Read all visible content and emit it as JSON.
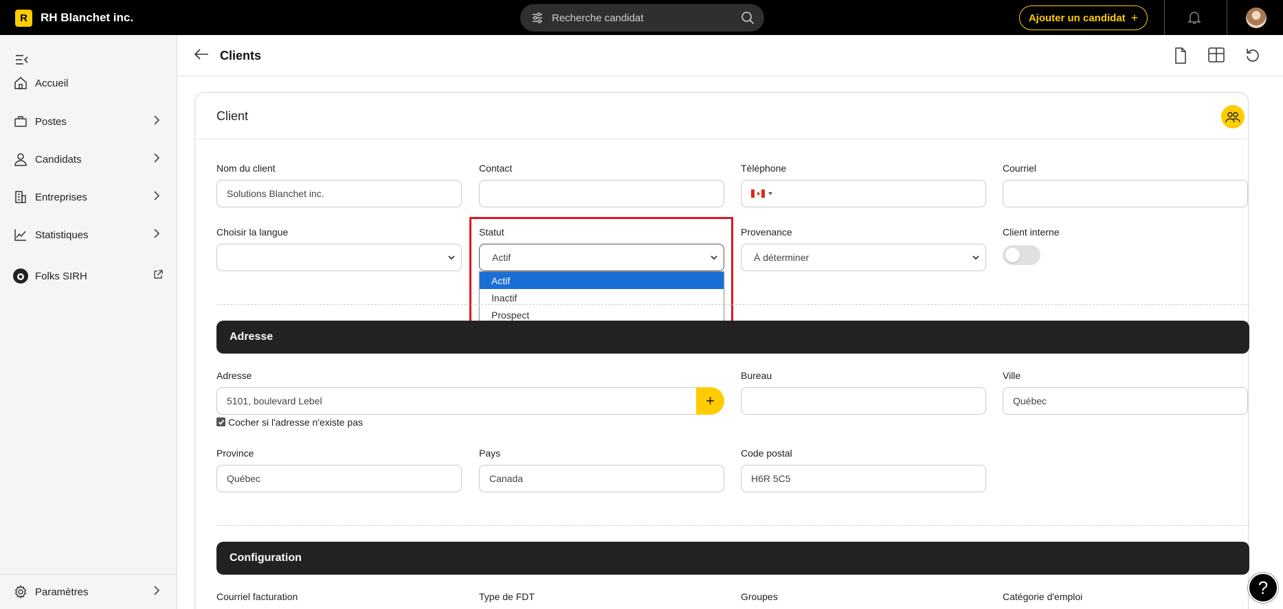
{
  "app": {
    "logo_letter": "R",
    "brand": "RH Blanchet inc."
  },
  "topbar": {
    "search_placeholder": "Recherche candidat",
    "add_candidate_label": "Ajouter un candidat",
    "add_candidate_icon": "+"
  },
  "sidebar": {
    "items": [
      {
        "label": "Accueil",
        "icon": "home-icon"
      },
      {
        "label": "Postes",
        "icon": "briefcase-icon",
        "chevron": "›"
      },
      {
        "label": "Candidats",
        "icon": "user-icon",
        "chevron": "›"
      },
      {
        "label": "Entreprises",
        "icon": "building-icon",
        "chevron": "›"
      },
      {
        "label": "Statistiques",
        "icon": "chart-icon",
        "chevron": "›"
      },
      {
        "label": "Folks SIRH",
        "icon": "folks-logo-icon",
        "external": "external-link-icon"
      }
    ],
    "settings_label": "Paramètres",
    "settings_chevron": "›"
  },
  "page": {
    "title": "Clients"
  },
  "card": {
    "title": "Client",
    "fields": {
      "client_name_label": "Nom du client",
      "client_name_value": "Solutions Blanchet inc.",
      "contact_label": "Contact",
      "contact_value": "",
      "phone_label": "Téléphone",
      "phone_value": "",
      "email_label": "Courriel",
      "email_value": "",
      "language_label": "Choisir la langue",
      "language_value": "",
      "status_label": "Statut",
      "status_value": "Actif",
      "status_options": [
        "Actif",
        "Inactif",
        "Prospect"
      ],
      "source_label": "Provenance",
      "source_value": "À déterminer",
      "internal_label": "Client interne",
      "internal_on": false
    },
    "address_section": {
      "title": "Adresse",
      "address_label": "Adresse",
      "address_value": "5101, boulevard Lebel",
      "address_add_icon": "+",
      "office_label": "Bureau",
      "office_value": "",
      "city_label": "Ville",
      "city_value": "Québec",
      "checkbox_label": "Cocher si l'adresse n'existe pas",
      "checkbox_checked": true,
      "province_label": "Province",
      "province_value": "Québec",
      "country_label": "Pays",
      "country_value": "Canada",
      "postal_label": "Code postal",
      "postal_value": "H6R 5C5"
    },
    "config_section": {
      "title": "Configuration",
      "billing_email_label": "Courriel facturation",
      "fdt_type_label": "Type de FDT",
      "groups_label": "Groupes",
      "job_category_label": "Catégorie d'emploi"
    }
  },
  "help_label": "?",
  "colors": {
    "accent": "#ffcc00",
    "highlight": "#e0161f",
    "selected": "#1a6fd6"
  }
}
